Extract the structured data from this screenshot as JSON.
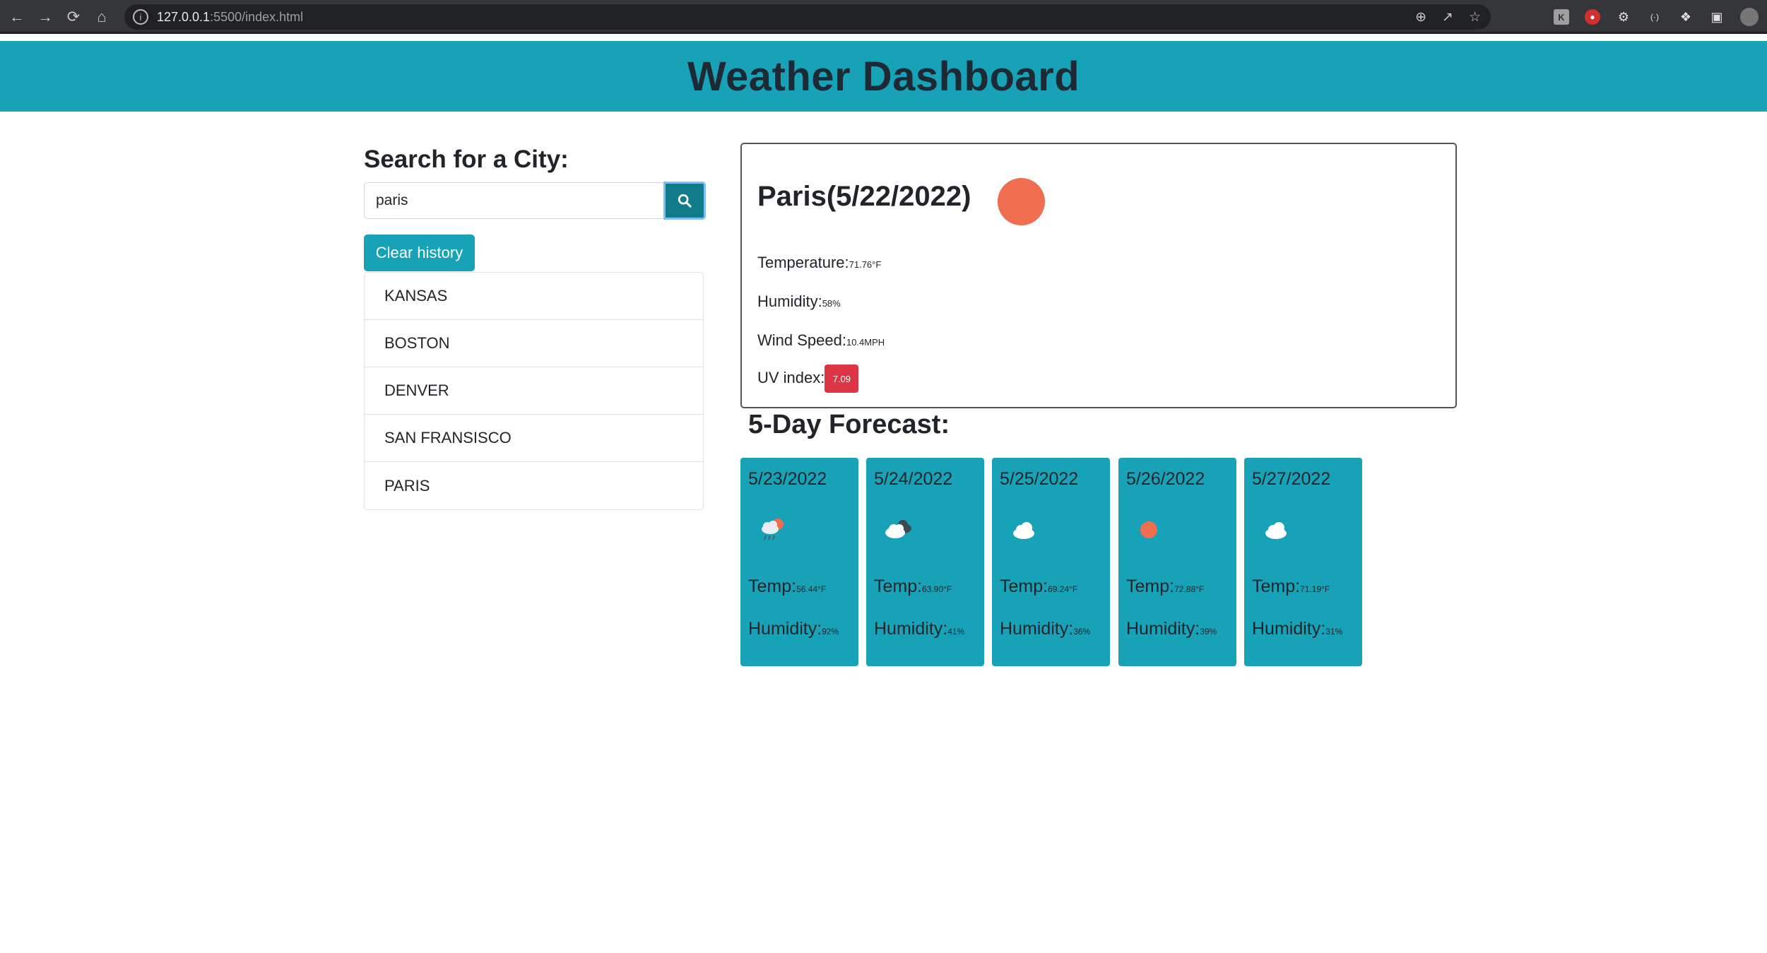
{
  "browser": {
    "url_host": "127.0.0.1",
    "url_rest": ":5500/index.html"
  },
  "header": {
    "title": "Weather Dashboard"
  },
  "search": {
    "title": "Search for a City:",
    "value": "paris",
    "clear_label": "Clear history"
  },
  "history": [
    "KANSAS",
    "BOSTON",
    "DENVER",
    "SAN FRANSISCO",
    "PARIS"
  ],
  "current": {
    "city_date": "Paris(5/22/2022)",
    "icon": "sun-icon",
    "temperature_label": "Temperature:",
    "temperature_value": "71.76°F",
    "humidity_label": "Humidity:",
    "humidity_value": "58%",
    "wind_label": "Wind Speed:",
    "wind_value": "10.4MPH",
    "uv_label": "UV index:",
    "uv_value": "7.09",
    "uv_color": "#dc3545"
  },
  "forecast": {
    "title": "5-Day Forecast:",
    "temp_label": "Temp:",
    "humidity_label": "Humidity:",
    "days": [
      {
        "date": "5/23/2022",
        "icon": "rain-sun-icon",
        "temp": "56.44°F",
        "humidity": "92%"
      },
      {
        "date": "5/24/2022",
        "icon": "dark-clouds-icon",
        "temp": "63.90°F",
        "humidity": "41%"
      },
      {
        "date": "5/25/2022",
        "icon": "cloud-icon",
        "temp": "69.24°F",
        "humidity": "36%"
      },
      {
        "date": "5/26/2022",
        "icon": "sun-icon",
        "temp": "72.88°F",
        "humidity": "39%"
      },
      {
        "date": "5/27/2022",
        "icon": "cloud-icon",
        "temp": "71.19°F",
        "humidity": "31%"
      }
    ]
  },
  "colors": {
    "accent": "#17a2b8",
    "sun": "#ee6e4f"
  }
}
